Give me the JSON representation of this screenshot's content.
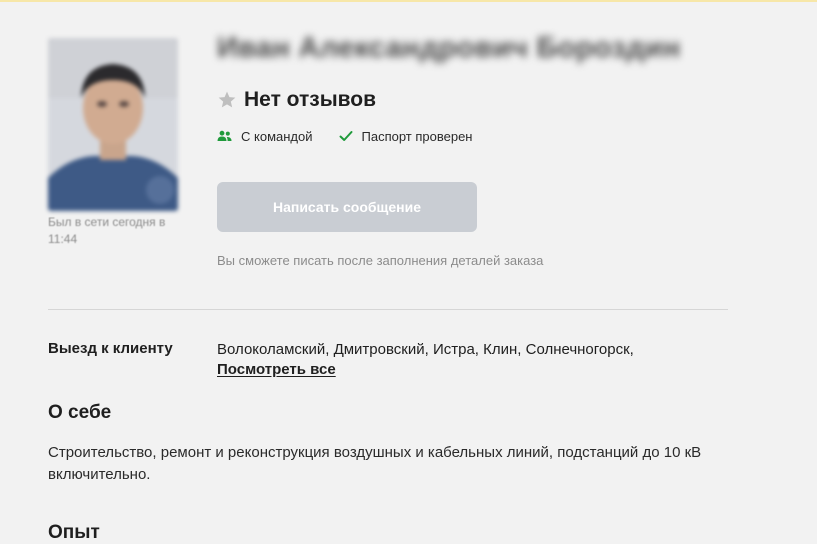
{
  "profile": {
    "name": "Иван Александрович Бороздин",
    "last_seen": "Был в сети сегодня в 11:44",
    "rating_text": "Нет отзывов",
    "badges": {
      "team": "С командой",
      "passport": "Паспорт проверен"
    },
    "message_button": "Написать сообщение",
    "message_hint": "Вы сможете писать после заполнения деталей заказа"
  },
  "details": {
    "visit_label": "Выезд к клиенту",
    "visit_areas": "Волоколамский, Дмитровский, Истра, Клин, Солнечногорск,",
    "visit_more": "Посмотреть все",
    "about_title": "О себе",
    "about_text": "Строительство, ремонт и реконструкция воздушных и кабельных линий, подстанций до 10 кВ включительно.",
    "experience_title": "Опыт"
  },
  "colors": {
    "accent_green": "#1f9a3b",
    "button_disabled": "#c9cdd3",
    "muted_text": "#8c8c8c",
    "star_gray": "#bfbfbf"
  },
  "icons": {
    "rating": "star-icon",
    "team": "team-icon",
    "passport": "check-icon"
  }
}
